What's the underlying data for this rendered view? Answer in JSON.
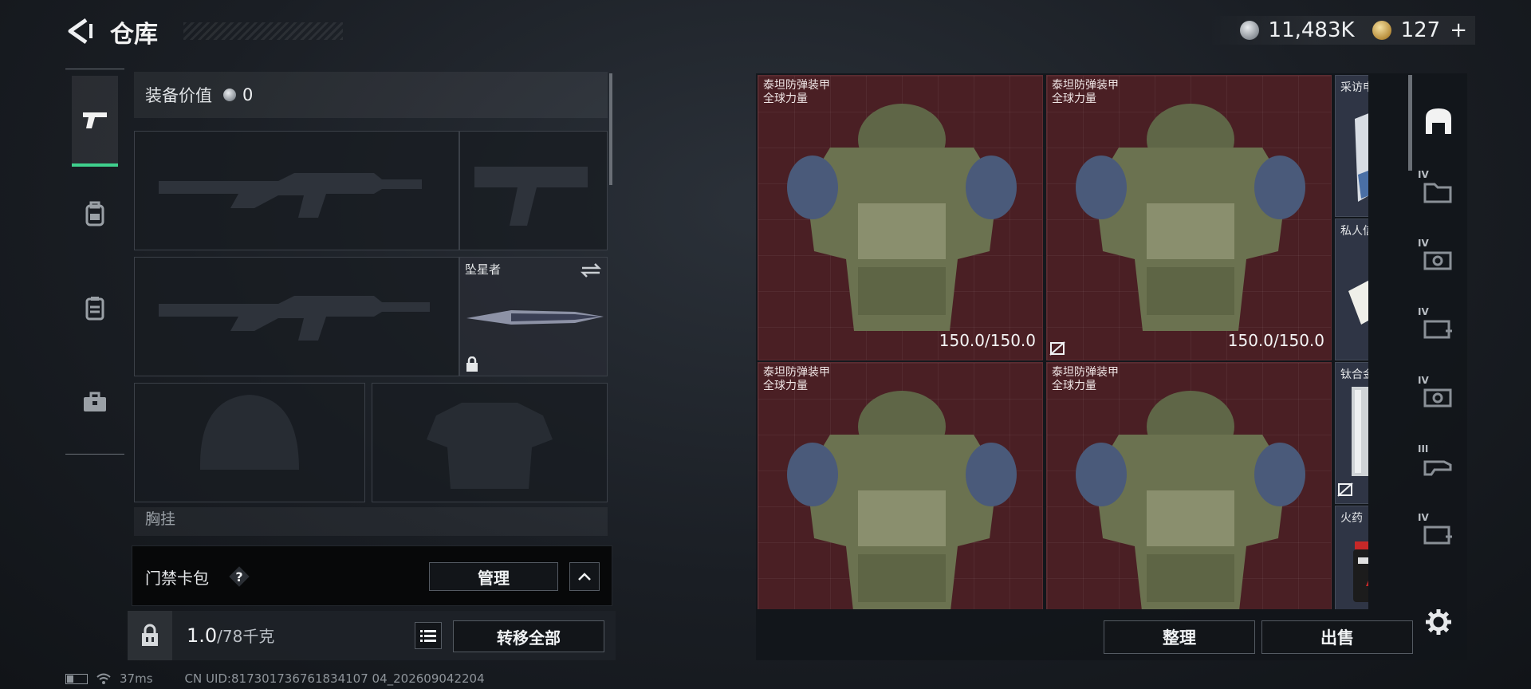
{
  "header": {
    "title": "仓库",
    "currency_silver": "11,483K",
    "currency_gold": "127",
    "plus": "+"
  },
  "left_nav": {
    "items": [
      {
        "icon": "pistol-icon",
        "active": true
      },
      {
        "icon": "backpack-icon",
        "active": false
      },
      {
        "icon": "vest-icon",
        "active": false
      },
      {
        "icon": "toolbox-icon",
        "active": false
      }
    ]
  },
  "loadout": {
    "equip_value_label": "装备价值",
    "equip_value": "0",
    "melee_label": "坠星者",
    "chest_rig_label": "胸挂"
  },
  "cardpack": {
    "label": "门禁卡包",
    "help": "?",
    "manage_label": "管理"
  },
  "footer_left": {
    "weight_current": "1.0",
    "weight_max": "/78千克",
    "transfer_all_label": "转移全部"
  },
  "status_bar": {
    "ping": "37ms",
    "uid": "CN UID:817301736761834107 04_202609042204"
  },
  "stash": {
    "armor_items": [
      {
        "name": "泰坦防弹装甲",
        "subtitle": "全球力量",
        "durability": "150.0/150.0"
      },
      {
        "name": "泰坦防弹装甲",
        "subtitle": "全球力量",
        "durability": "150.0/150.0"
      },
      {
        "name": "泰坦防弹装甲",
        "subtitle": "全球力量",
        "durability": ""
      },
      {
        "name": "泰坦防弹装甲",
        "subtitle": "全球力量",
        "durability": ""
      }
    ],
    "side_items": [
      {
        "name": "采访申请函"
      },
      {
        "name": "私人信件"
      },
      {
        "name": "钛合金"
      },
      {
        "name": "火药"
      }
    ],
    "organize_label": "整理",
    "sell_label": "出售"
  },
  "right_strip": {
    "tiers": [
      "IV",
      "IV",
      "IV",
      "IV",
      "III",
      "IV"
    ]
  }
}
